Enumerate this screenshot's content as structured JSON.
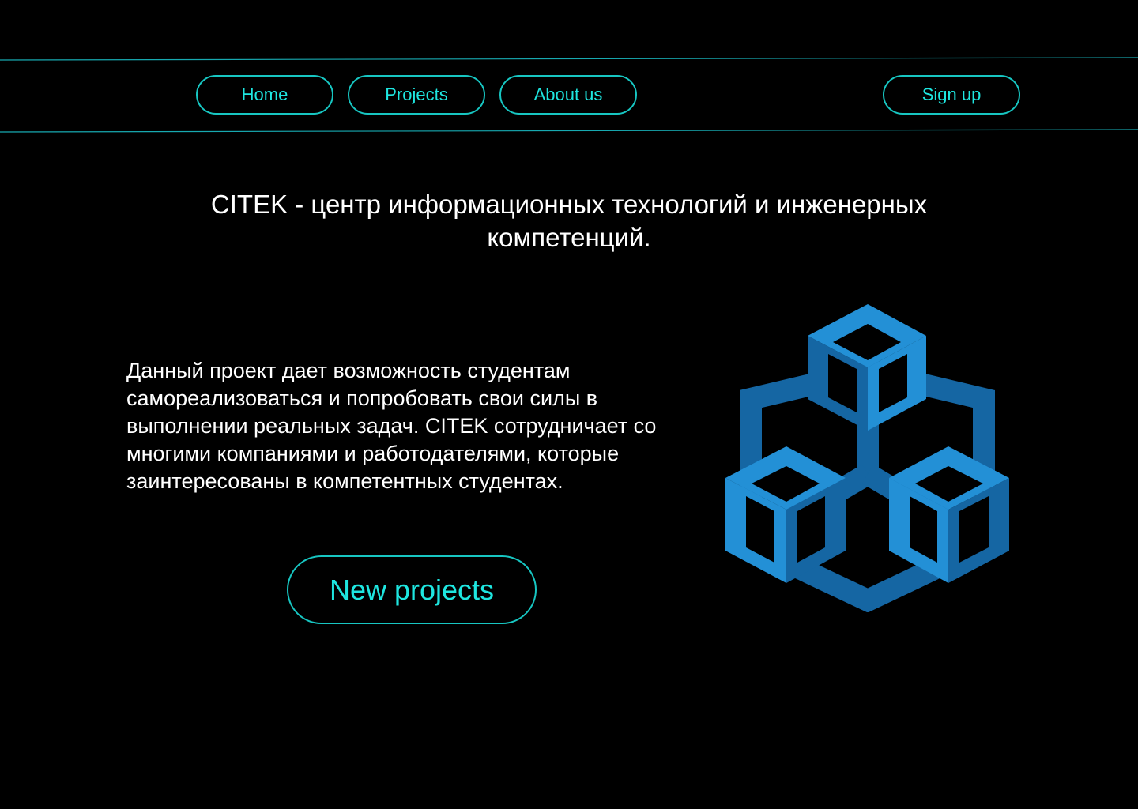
{
  "nav": {
    "home_label": "Home",
    "projects_label": "Projects",
    "about_label": "About us",
    "signup_label": "Sign up"
  },
  "hero": {
    "headline": "CITEK - центр информационных технологий и инженерных компетенций.",
    "description": "Данный проект дает возможность студентам самореализоваться и попробовать свои силы в выполнении реальных задач. CITEK сотрудничает со многими компаниями и работодателями, которые заинтересованы в компетентных студентах.",
    "cta_label": "New projects"
  },
  "logo": {
    "icon": "interlocking-cubes-logo-icon"
  },
  "colors": {
    "background": "#000000",
    "accent": "#1ee6e0",
    "accent_border": "#17c6c2",
    "text": "#ffffff",
    "logo_light": "#2390d6",
    "logo_dark": "#1566a3"
  }
}
